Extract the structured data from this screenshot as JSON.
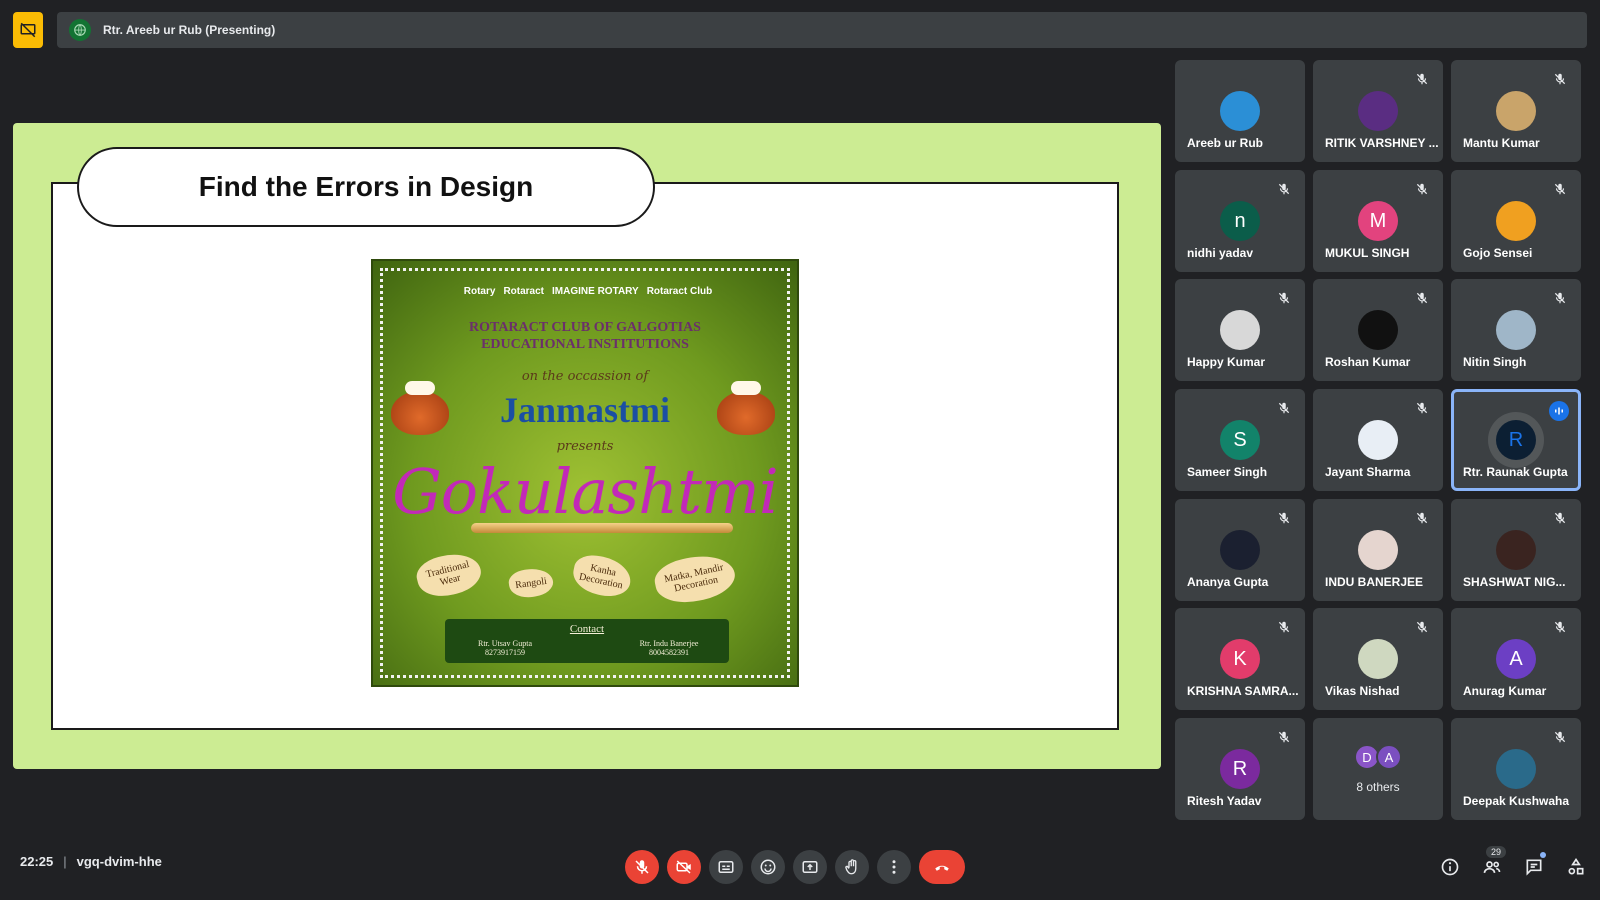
{
  "presenting": {
    "label": "Rtr. Areeb ur Rub (Presenting)"
  },
  "slide": {
    "title": "Find the Errors in Design",
    "poster": {
      "logos": [
        "Rotary",
        "Rotaract",
        "IMAGINE ROTARY",
        "Rotaract Club"
      ],
      "org_line1": "ROTARACT CLUB OF GALGOTIAS",
      "org_line2": "EDUCATIONAL INSTITUTIONS",
      "occasion": "on the occassion of",
      "event": "Janmastmi",
      "presents": "presents",
      "main_title": "Gokulashtmi",
      "tags": [
        "Traditional Wear",
        "Rangoli",
        "Kanha Decoration",
        "Matka, Mandir Decoration"
      ],
      "contact_title": "Contact",
      "contact1_name": "Rtr. Utsav Gupta",
      "contact1_phone": "8273917159",
      "contact2_name": "Rtr. Indu Banerjee",
      "contact2_phone": "8004582391"
    }
  },
  "participants": [
    {
      "name": "Areeb ur Rub",
      "initial": "",
      "avatar_color": "#2b8fd6",
      "muted": false
    },
    {
      "name": "RITIK VARSHNEY ...",
      "initial": "",
      "avatar_color": "#5a2d82",
      "muted": true
    },
    {
      "name": "Mantu Kumar",
      "initial": "",
      "avatar_color": "#c9a46a",
      "muted": true
    },
    {
      "name": "nidhi yadav",
      "initial": "n",
      "avatar_color": "#0b5d4a",
      "muted": true
    },
    {
      "name": "MUKUL SINGH",
      "initial": "M",
      "avatar_color": "#e2437e",
      "muted": true
    },
    {
      "name": "Gojo Sensei",
      "initial": "",
      "avatar_color": "#f0a020",
      "muted": true
    },
    {
      "name": "Happy Kumar",
      "initial": "",
      "avatar_color": "#d8d8d8",
      "muted": true
    },
    {
      "name": "Roshan Kumar",
      "initial": "",
      "avatar_color": "#111111",
      "muted": true
    },
    {
      "name": "Nitin Singh",
      "initial": "",
      "avatar_color": "#9fb6c8",
      "muted": true
    },
    {
      "name": "Sameer Singh",
      "initial": "S",
      "avatar_color": "#12836a",
      "muted": true
    },
    {
      "name": "Jayant Sharma",
      "initial": "",
      "avatar_color": "#e8eef5",
      "muted": true
    },
    {
      "name": "Rtr. Raunak Gupta",
      "initial": "R",
      "avatar_color": "#0c1f33",
      "muted": false,
      "speaking": true
    },
    {
      "name": "Ananya Gupta",
      "initial": "",
      "avatar_color": "#1b2030",
      "muted": true
    },
    {
      "name": "INDU BANERJEE",
      "initial": "",
      "avatar_color": "#e5d5cf",
      "muted": true
    },
    {
      "name": "SHASHWAT NIG...",
      "initial": "",
      "avatar_color": "#3a2420",
      "muted": true
    },
    {
      "name": "KRISHNA SAMRA...",
      "initial": "K",
      "avatar_color": "#e23c6b",
      "muted": true
    },
    {
      "name": "Vikas Nishad",
      "initial": "",
      "avatar_color": "#cfd8c0",
      "muted": true
    },
    {
      "name": "Anurag Kumar",
      "initial": "A",
      "avatar_color": "#6c3fc4",
      "muted": true
    },
    {
      "name": "Ritesh Yadav",
      "initial": "R",
      "avatar_color": "#7b2a9e",
      "muted": true
    },
    {
      "name": "8 others",
      "others": true,
      "initials": [
        "D",
        "A"
      ],
      "colors": [
        "#8a55c8",
        "#7b4fc0"
      ]
    },
    {
      "name": "Deepak Kushwaha",
      "initial": "",
      "avatar_color": "#2a6a8a",
      "muted": true
    }
  ],
  "meeting": {
    "time": "22:25",
    "code": "vgq-dvim-hhe",
    "people_count": "29"
  },
  "colors": {
    "stage_bg": "#ccec93",
    "danger": "#ea4335",
    "accent": "#8ab4f8"
  }
}
